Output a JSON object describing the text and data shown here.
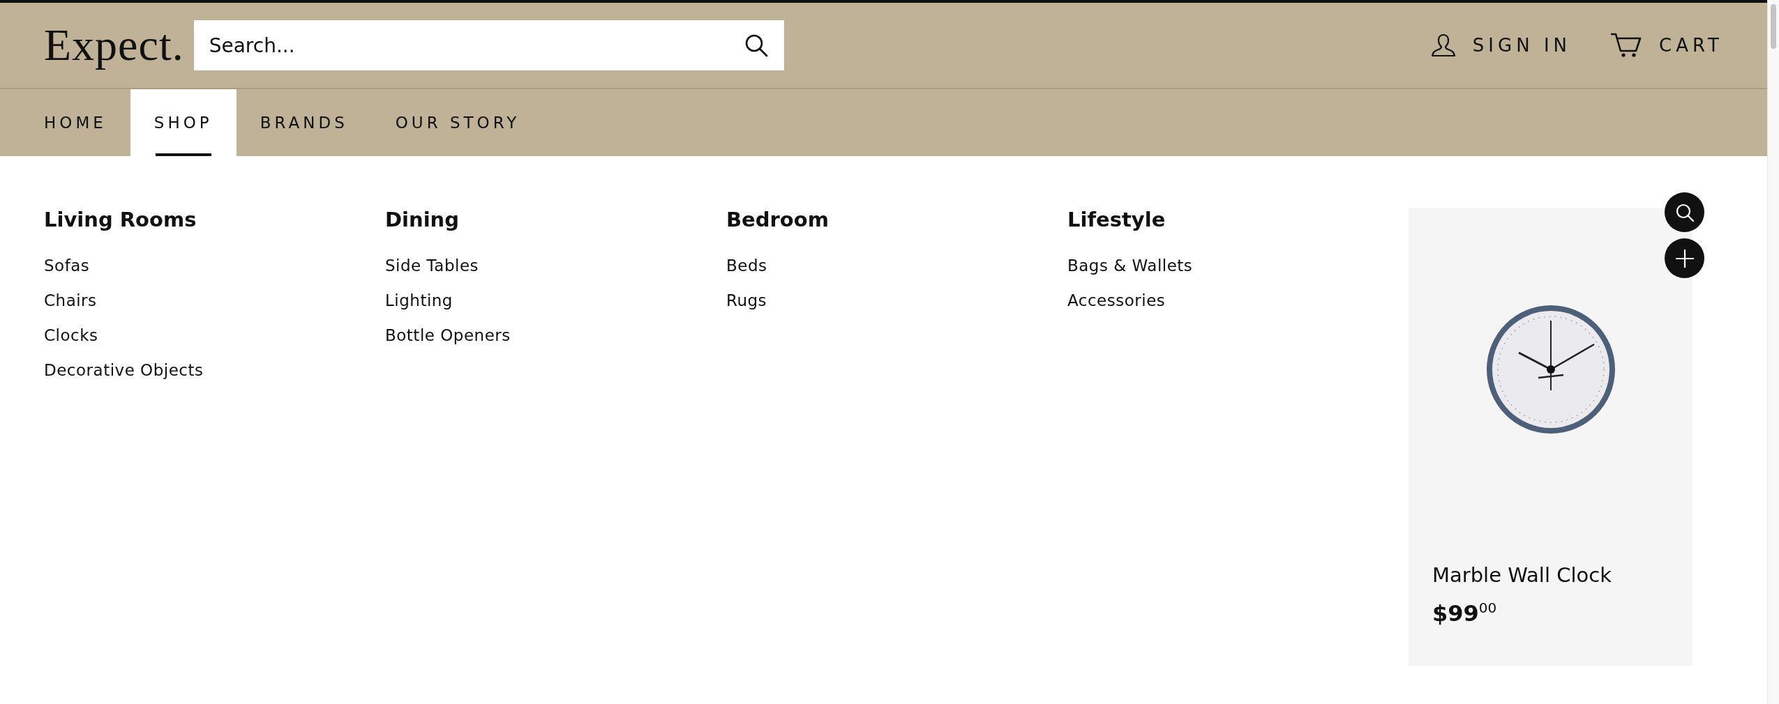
{
  "header": {
    "logo": "Expect.",
    "search": {
      "placeholder": "Search..."
    },
    "account": {
      "label": "SIGN IN"
    },
    "cart": {
      "label": "CART"
    }
  },
  "nav": [
    {
      "label": "HOME",
      "selected": false
    },
    {
      "label": "SHOP",
      "selected": true
    },
    {
      "label": "BRANDS",
      "selected": false
    },
    {
      "label": "OUR STORY",
      "selected": false
    }
  ],
  "menu_columns": [
    {
      "heading": "Living Rooms",
      "items": [
        "Sofas",
        "Chairs",
        "Clocks",
        "Decorative Objects"
      ]
    },
    {
      "heading": "Dining",
      "items": [
        "Side Tables",
        "Lighting",
        "Bottle Openers"
      ]
    },
    {
      "heading": "Bedroom",
      "items": [
        "Beds",
        "Rugs"
      ]
    },
    {
      "heading": "Lifestyle",
      "items": [
        "Bags & Wallets",
        "Accessories"
      ]
    }
  ],
  "product": {
    "kind": "picture",
    "title": "Marble Wall Clock",
    "price": "**$99**$^{00}$"
  }
}
